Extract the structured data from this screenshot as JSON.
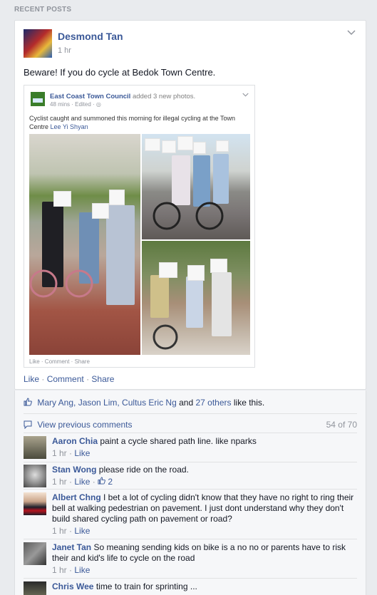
{
  "section_header": "RECENT POSTS",
  "post": {
    "author": "Desmond Tan",
    "time": "1 hr",
    "text": "Beware! If you do cycle at Bedok Town Centre.",
    "shared": {
      "page_name": "East Coast Town Council",
      "action": "added 3 new photos.",
      "meta": "48 mins · Edited · ◎",
      "caption": "Cyclist caught and summoned this morning for illegal cycling at the Town Centre",
      "tag": "Lee Yi Shyan",
      "actions": "Like · Comment · Share"
    },
    "actions": {
      "like": "Like",
      "comment": "Comment",
      "share": "Share"
    }
  },
  "likes": {
    "names": "Mary Ang, Jason Lim, Cultus Eric Ng",
    "and": "and",
    "others": "27 others",
    "suffix": "like this."
  },
  "comments_bar": {
    "view_previous": "View previous comments",
    "count": "54 of 70"
  },
  "comments": [
    {
      "name": "Aaron Chia",
      "text": "paint a cycle shared path line. like nparks",
      "time": "1 hr",
      "like": "Like",
      "likes": ""
    },
    {
      "name": "Stan Wong",
      "text": "please ride on the road.",
      "time": "1 hr",
      "like": "Like",
      "likes": "2"
    },
    {
      "name": "Albert Chng",
      "text": "I bet a lot of cycling didn't know that they have no right to ring their bell at walking pedestrian on pavement. I just dont understand why they don't build shared cycling path on pavement or road?",
      "time": "1 hr",
      "like": "Like",
      "likes": ""
    },
    {
      "name": "Janet Tan",
      "text": "So meaning sending kids on bike is a no no or parents have to risk their and kid's life to cycle on the road",
      "time": "1 hr",
      "like": "Like",
      "likes": ""
    },
    {
      "name": "Chris Wee",
      "text": "time to train for sprinting ...",
      "time": "",
      "like": "",
      "likes": ""
    }
  ]
}
